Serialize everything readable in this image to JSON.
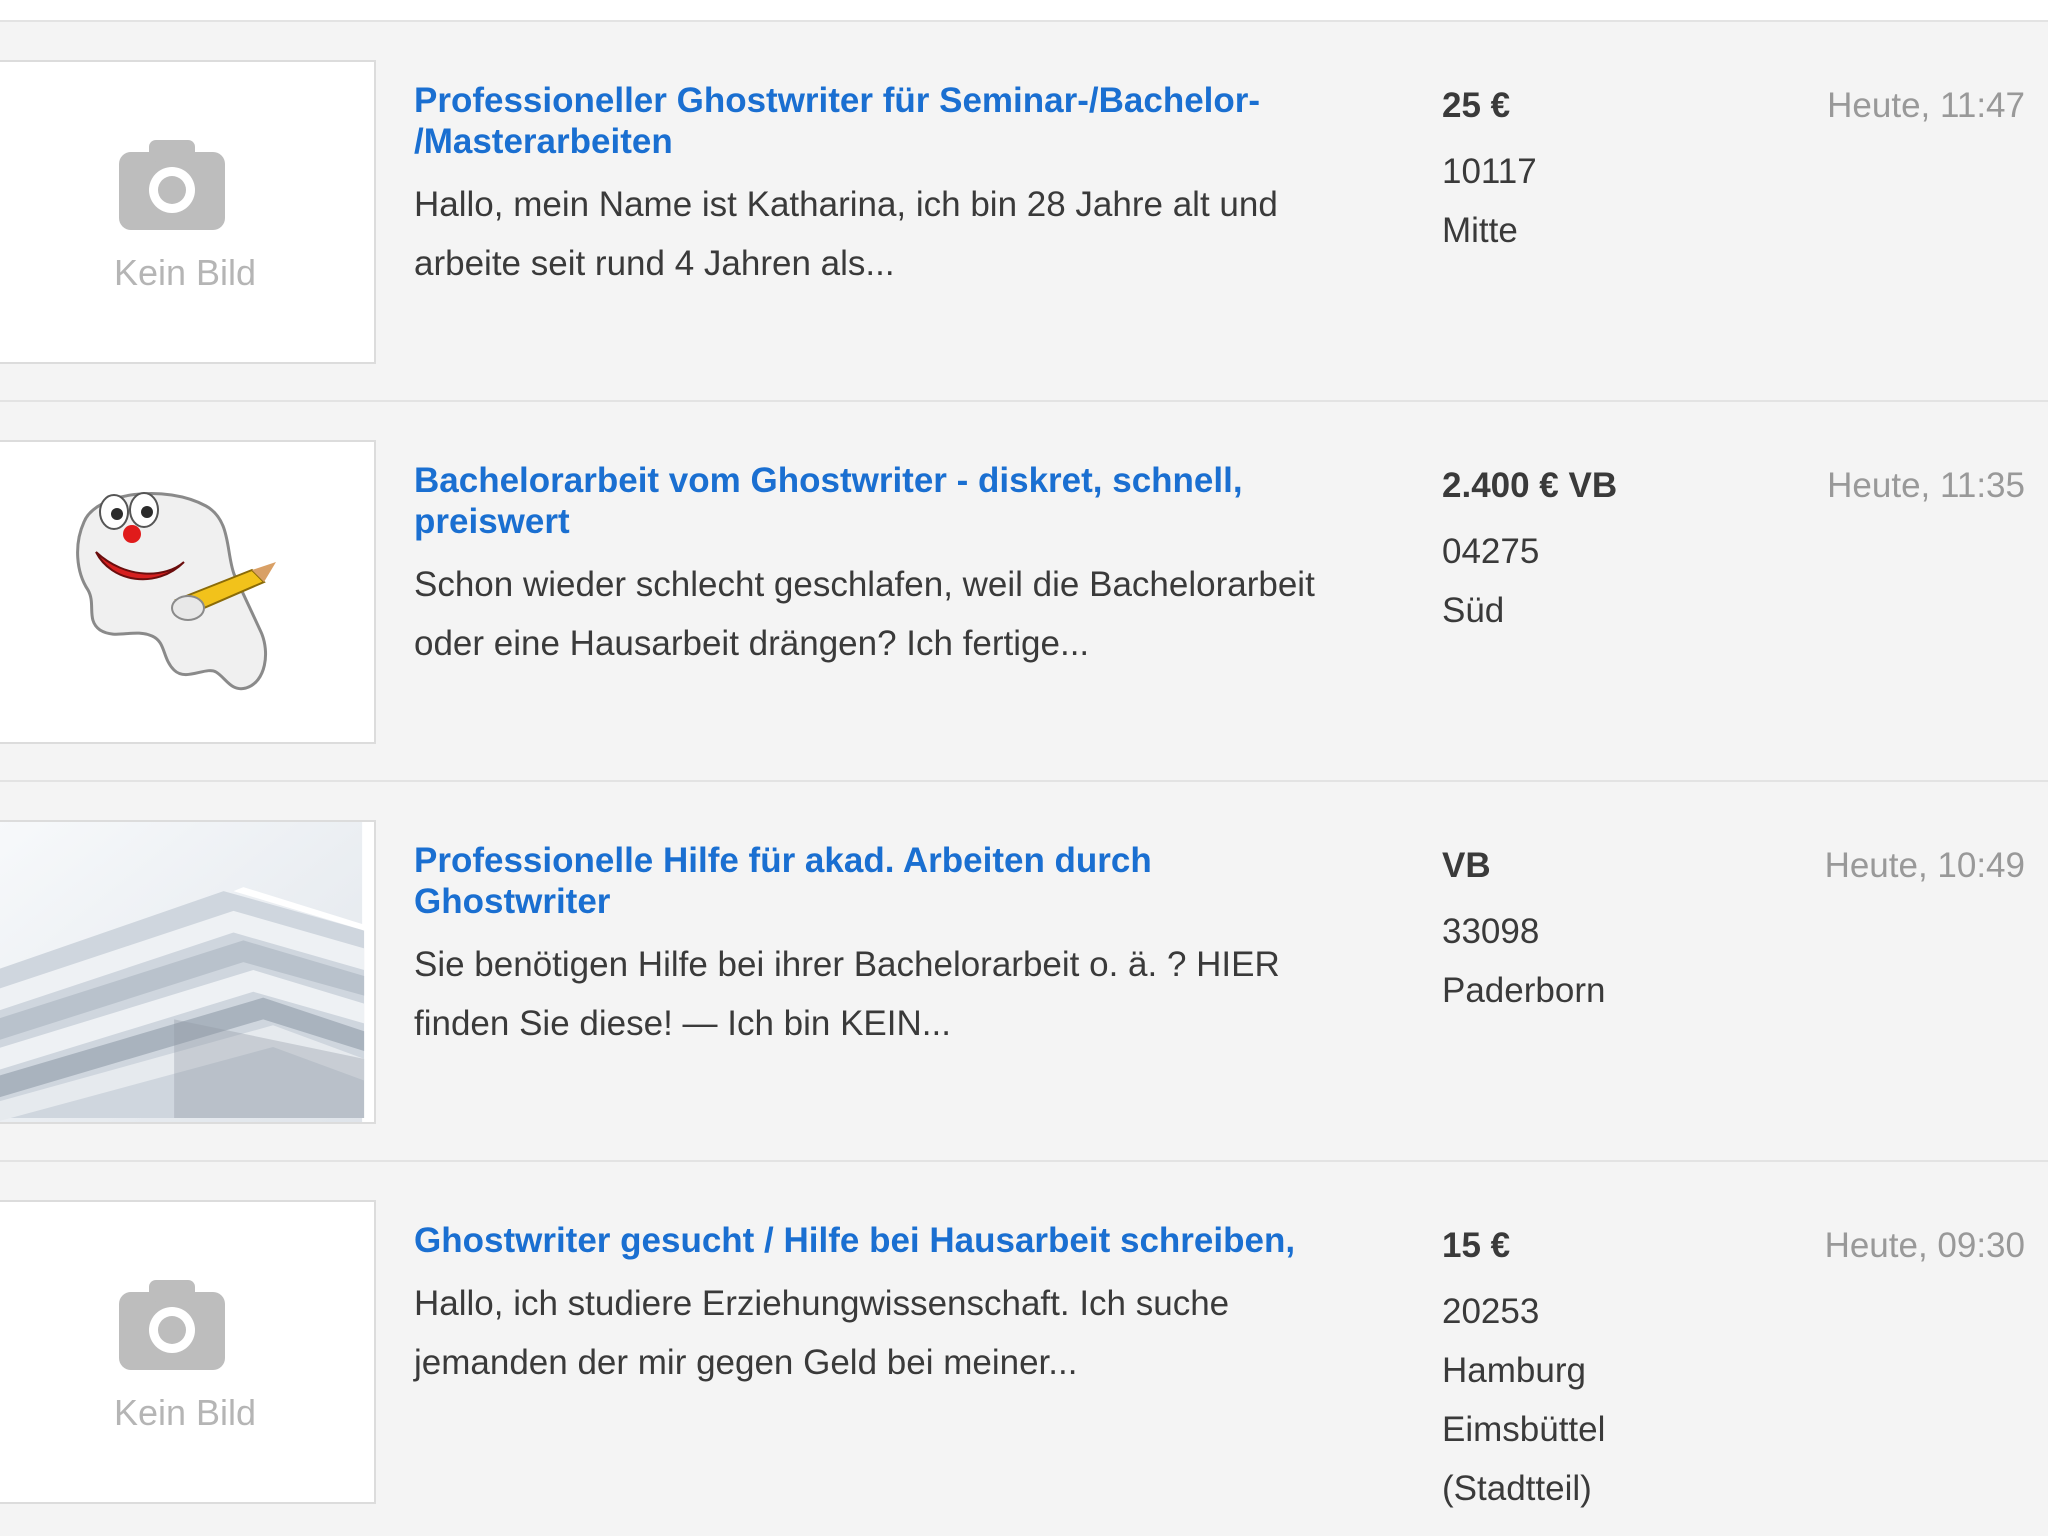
{
  "listings": [
    {
      "title": "Professioneller Ghostwriter für Seminar-/Bachelor-\n/Masterarbeiten",
      "description": "Hallo, mein Name ist Katharina, ich bin 28 Jahre alt und\narbeite seit rund 4 Jahren als...",
      "price": "25 €",
      "location": "10117\nMitte",
      "date": "Heute, 11:47",
      "image_placeholder": "Kein Bild",
      "image": "camera-icon"
    },
    {
      "title": "Bachelorarbeit vom Ghostwriter - diskret, schnell,\npreiswert",
      "description": "Schon wieder schlecht geschlafen, weil die Bachelorarbeit\noder eine Hausarbeit drängen? Ich fertige...",
      "price": "2.400 € VB",
      "location": "04275\nSüd",
      "date": "Heute, 11:35",
      "image": "ghost-with-pencil-icon"
    },
    {
      "title": "Professionelle Hilfe für akad. Arbeiten durch\nGhostwriter",
      "description": "Sie benötigen Hilfe bei ihrer Bachelorarbeit o. ä. ? HIER\nfinden Sie diese! — Ich bin KEIN...",
      "price": "VB",
      "location": "33098\nPaderborn",
      "date": "Heute, 10:49",
      "image": "paper-stack-photo"
    },
    {
      "title": "Ghostwriter gesucht / Hilfe bei Hausarbeit schreiben,",
      "description": "Hallo, ich studiere Erziehungwissenschaft. Ich suche\njemanden der mir gegen Geld bei meiner...",
      "price": "15 €",
      "location": "20253\nHamburg\nEimsbüttel\n(Stadtteil)",
      "date": "Heute, 09:30",
      "image_placeholder": "Kein Bild",
      "image": "camera-icon"
    }
  ],
  "colors": {
    "title_link": "#1a6fd1",
    "row_background": "#f4f4f4",
    "text": "#3a3a3a",
    "muted": "#999999"
  }
}
